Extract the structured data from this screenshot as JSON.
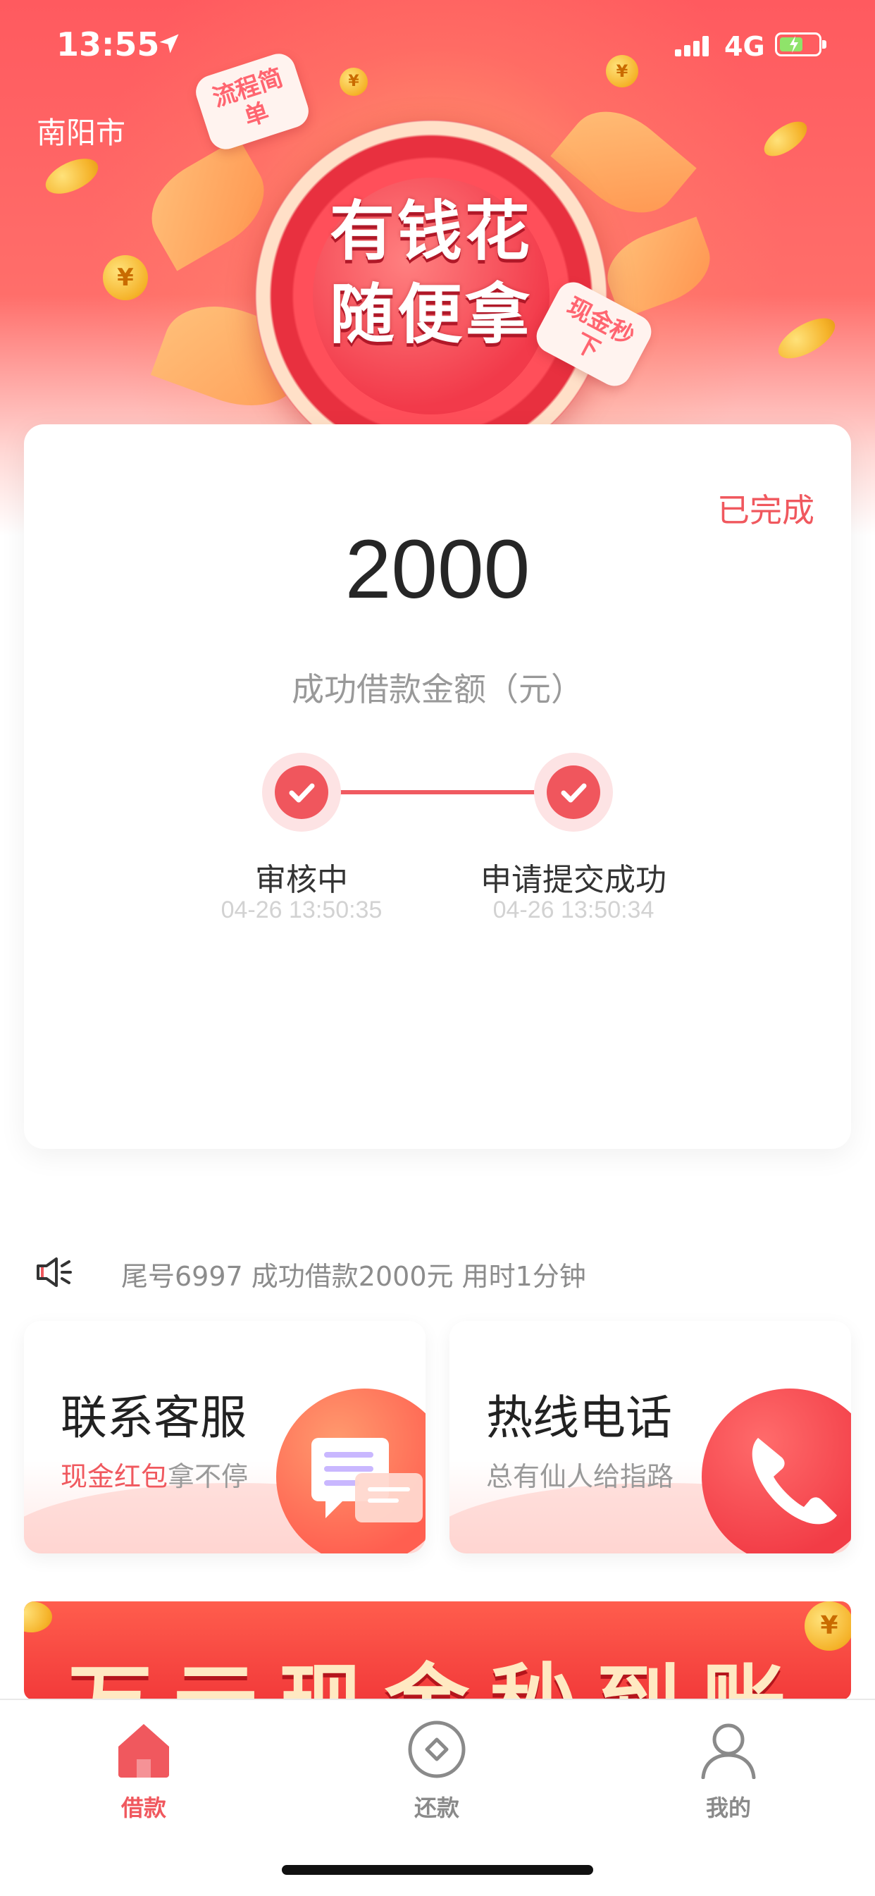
{
  "status_bar": {
    "time": "13:55",
    "network": "4G"
  },
  "header": {
    "city": "南阳市",
    "badge_line1": "有钱花",
    "badge_line2": "随便拿",
    "scroll_left": "流程简单",
    "scroll_right": "现金秒下"
  },
  "loan_card": {
    "status": "已完成",
    "amount": "2000",
    "amount_label": "成功借款金额（元）",
    "steps": [
      {
        "title": "审核中",
        "time": "04-26 13:50:35"
      },
      {
        "title": "申请提交成功",
        "time": "04-26 13:50:34"
      }
    ]
  },
  "notice": {
    "icon": "speaker-icon",
    "text": "尾号6997 成功借款2000元 用时1分钟"
  },
  "services": [
    {
      "title": "联系客服",
      "sub_highlight": "现金红包",
      "sub_rest": "拿不停",
      "icon": "chat-icon"
    },
    {
      "title": "热线电话",
      "sub_highlight": "",
      "sub_rest": "总有仙人给指路",
      "icon": "phone-icon"
    }
  ],
  "banner": {
    "text": "万元现金秒到账"
  },
  "tabbar": {
    "items": [
      {
        "label": "借款",
        "icon": "home-icon",
        "active": true
      },
      {
        "label": "还款",
        "icon": "repay-icon",
        "active": false
      },
      {
        "label": "我的",
        "icon": "user-icon",
        "active": false
      }
    ]
  },
  "colors": {
    "accent": "#f0585e",
    "hero_top": "#ff5a5f"
  }
}
